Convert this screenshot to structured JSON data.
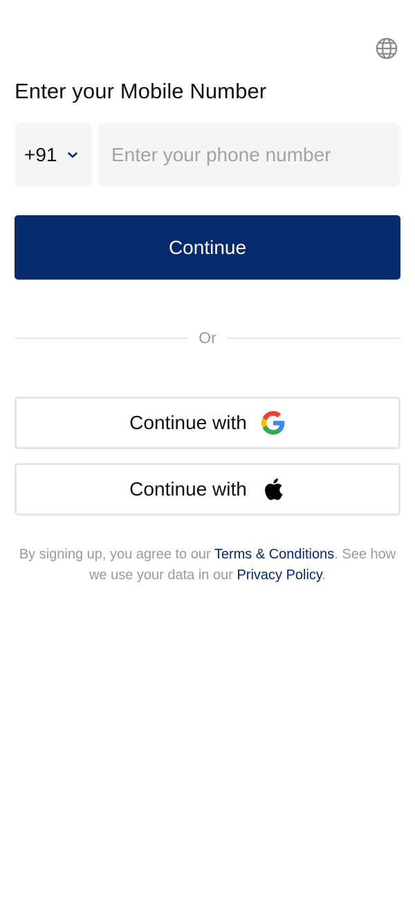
{
  "header": {
    "title": "Enter your Mobile Number",
    "language_icon": "globe-icon"
  },
  "phone": {
    "country_code": "+91",
    "country_code_icon": "chevron-down-icon",
    "value": "",
    "placeholder": "Enter your phone number"
  },
  "actions": {
    "continue_label": "Continue",
    "divider_label": "Or",
    "google_label": "Continue with",
    "google_icon": "google-logo-icon",
    "apple_label": "Continue with",
    "apple_icon": "apple-logo-icon"
  },
  "legal": {
    "prefix": "By signing up, you agree to our ",
    "terms_link": "Terms & Conditions",
    "middle": ". See how we use your data in our ",
    "privacy_link": "Privacy Policy",
    "suffix": "."
  },
  "colors": {
    "primary": "#062a6c",
    "input_background": "#f5f5f5",
    "muted_text": "#9a9a9a",
    "border": "#e5e5e5"
  }
}
